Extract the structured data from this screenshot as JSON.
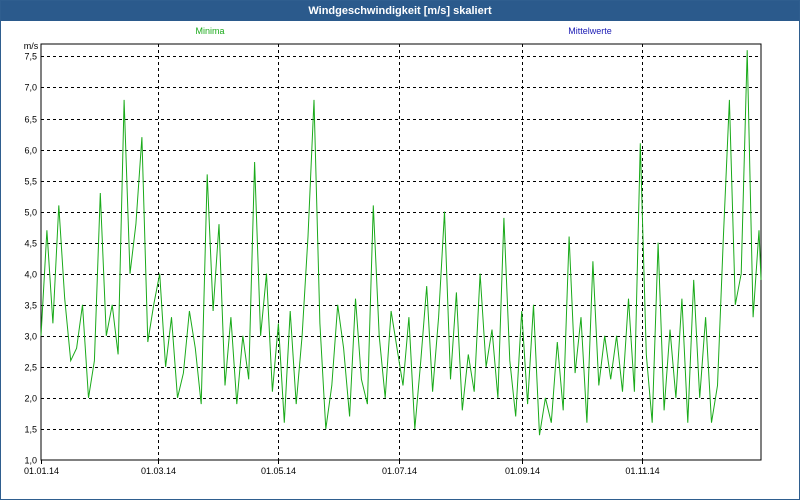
{
  "window": {
    "title": "Windgeschwindigkeit [m/s] skaliert"
  },
  "legend": {
    "minima_label": "Minima",
    "mittelwerte_label": "Mittelwerte"
  },
  "colors": {
    "titlebar": "#2b5a8c",
    "series_minima": "#1aaa1a",
    "series_mittelwerte": "#1a1ab4",
    "grid": "#000000",
    "axis_text": "#000000"
  },
  "chart_data": {
    "type": "line",
    "ylabel": "m/s",
    "xlabel": "",
    "ylim": [
      1.0,
      7.7
    ],
    "yticks": [
      "1,0",
      "1,5",
      "2,0",
      "2,5",
      "3,0",
      "3,5",
      "4,0",
      "4,5",
      "5,0",
      "5,5",
      "6,0",
      "6,5",
      "7,0",
      "7,5"
    ],
    "ytick_values": [
      1.0,
      1.5,
      2.0,
      2.5,
      3.0,
      3.5,
      4.0,
      4.5,
      5.0,
      5.5,
      6.0,
      6.5,
      7.0,
      7.5
    ],
    "xlim": [
      "2014-01-01",
      "2014-12-31"
    ],
    "xticks": [
      "01.01.14",
      "01.03.14",
      "01.05.14",
      "01.07.14",
      "01.09.14",
      "01.11.14"
    ],
    "xtick_dates": [
      "2014-01-01",
      "2014-03-01",
      "2014-05-01",
      "2014-07-01",
      "2014-09-01",
      "2014-11-01"
    ],
    "grid": true,
    "grid_style": "dashed",
    "series": [
      {
        "name": "Minima",
        "color": "#1aaa1a",
        "x": [
          "2014-01-01",
          "2014-01-04",
          "2014-01-07",
          "2014-01-10",
          "2014-01-13",
          "2014-01-16",
          "2014-01-19",
          "2014-01-22",
          "2014-01-25",
          "2014-01-28",
          "2014-01-31",
          "2014-02-03",
          "2014-02-06",
          "2014-02-09",
          "2014-02-12",
          "2014-02-15",
          "2014-02-18",
          "2014-02-21",
          "2014-02-24",
          "2014-02-27",
          "2014-03-02",
          "2014-03-05",
          "2014-03-08",
          "2014-03-11",
          "2014-03-14",
          "2014-03-17",
          "2014-03-20",
          "2014-03-23",
          "2014-03-26",
          "2014-03-29",
          "2014-04-01",
          "2014-04-04",
          "2014-04-07",
          "2014-04-10",
          "2014-04-13",
          "2014-04-16",
          "2014-04-19",
          "2014-04-22",
          "2014-04-25",
          "2014-04-28",
          "2014-05-01",
          "2014-05-04",
          "2014-05-07",
          "2014-05-10",
          "2014-05-13",
          "2014-05-16",
          "2014-05-19",
          "2014-05-22",
          "2014-05-25",
          "2014-05-28",
          "2014-05-31",
          "2014-06-03",
          "2014-06-06",
          "2014-06-09",
          "2014-06-12",
          "2014-06-15",
          "2014-06-18",
          "2014-06-21",
          "2014-06-24",
          "2014-06-27",
          "2014-06-30",
          "2014-07-03",
          "2014-07-06",
          "2014-07-09",
          "2014-07-12",
          "2014-07-15",
          "2014-07-18",
          "2014-07-21",
          "2014-07-24",
          "2014-07-27",
          "2014-07-30",
          "2014-08-02",
          "2014-08-05",
          "2014-08-08",
          "2014-08-11",
          "2014-08-14",
          "2014-08-17",
          "2014-08-20",
          "2014-08-23",
          "2014-08-26",
          "2014-08-29",
          "2014-09-01",
          "2014-09-04",
          "2014-09-07",
          "2014-09-10",
          "2014-09-13",
          "2014-09-16",
          "2014-09-19",
          "2014-09-22",
          "2014-09-25",
          "2014-09-28",
          "2014-10-01",
          "2014-10-04",
          "2014-10-07",
          "2014-10-10",
          "2014-10-13",
          "2014-10-16",
          "2014-10-19",
          "2014-10-22",
          "2014-10-25",
          "2014-10-28",
          "2014-10-31",
          "2014-11-03",
          "2014-11-06",
          "2014-11-09",
          "2014-11-12",
          "2014-11-15",
          "2014-11-18",
          "2014-11-21",
          "2014-11-24",
          "2014-11-27",
          "2014-11-30",
          "2014-12-03",
          "2014-12-06",
          "2014-12-09",
          "2014-12-12",
          "2014-12-15",
          "2014-12-18",
          "2014-12-21",
          "2014-12-24",
          "2014-12-27",
          "2014-12-30",
          "2014-12-31"
        ],
        "values": [
          3.0,
          4.7,
          3.2,
          5.1,
          3.6,
          2.6,
          2.8,
          3.5,
          2.0,
          2.6,
          5.3,
          3.0,
          3.5,
          2.7,
          6.8,
          4.0,
          4.8,
          6.2,
          2.9,
          3.5,
          4.0,
          2.5,
          3.3,
          2.0,
          2.4,
          3.4,
          2.8,
          1.9,
          5.6,
          3.4,
          4.8,
          2.2,
          3.3,
          1.9,
          3.0,
          2.3,
          5.8,
          3.0,
          4.0,
          2.1,
          3.2,
          1.6,
          3.4,
          1.9,
          3.0,
          4.6,
          6.8,
          3.2,
          1.5,
          2.2,
          3.5,
          2.8,
          1.7,
          3.6,
          2.3,
          1.9,
          5.1,
          3.0,
          2.0,
          3.4,
          2.8,
          2.2,
          3.3,
          1.5,
          2.6,
          3.8,
          2.1,
          3.3,
          5.0,
          2.3,
          3.7,
          1.8,
          2.7,
          2.1,
          4.0,
          2.5,
          3.1,
          2.0,
          4.9,
          2.6,
          1.7,
          3.4,
          1.9,
          3.5,
          1.4,
          2.0,
          1.6,
          2.9,
          1.8,
          4.6,
          2.4,
          3.3,
          1.6,
          4.2,
          2.2,
          3.0,
          2.3,
          3.0,
          2.1,
          3.6,
          2.1,
          6.1,
          2.7,
          1.6,
          4.5,
          1.8,
          3.1,
          2.0,
          3.6,
          1.6,
          3.9,
          2.0,
          3.3,
          1.6,
          2.2,
          4.6,
          6.8,
          3.5,
          4.0,
          7.6,
          3.3,
          4.7,
          3.9
        ]
      },
      {
        "name": "Mittelwerte",
        "color": "#1a1ab4",
        "x": [],
        "values": []
      }
    ]
  }
}
